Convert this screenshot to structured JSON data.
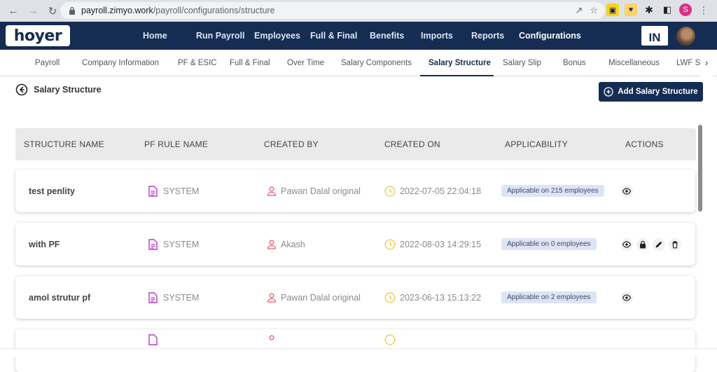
{
  "browser": {
    "url_host": "payroll.zimyo.work",
    "url_path": "/payroll/configurations/structure",
    "profile_initial": "S"
  },
  "topnav": {
    "logo": "hoyer",
    "items": [
      "Home",
      "Run Payroll",
      "Employees",
      "Full & Final",
      "Benefits",
      "Imports",
      "Reports",
      "Configurations"
    ],
    "active": "Configurations",
    "country_badge": "IN"
  },
  "subnav": {
    "items": [
      "Payroll",
      "Company Information",
      "PF & ESIC",
      "Full & Final",
      "Over Time",
      "Salary Components",
      "Salary Structure",
      "Salary Slip",
      "Bonus",
      "Miscellaneous",
      "LWF S"
    ],
    "active": "Salary Structure"
  },
  "page": {
    "title": "Salary Structure",
    "add_button": "Add Salary Structure"
  },
  "table": {
    "columns": [
      "STRUCTURE NAME",
      "PF RULE NAME",
      "CREATED BY",
      "CREATED ON",
      "APPLICABILITY",
      "ACTIONS"
    ],
    "rows": [
      {
        "name": "test penlity",
        "pf_rule": "SYSTEM",
        "created_by": "Pawan Dalal original",
        "created_on": "2022-07-05 22:04:18",
        "applicability": "Applicable on 215 employees",
        "actions": [
          "view-icon"
        ]
      },
      {
        "name": "with PF",
        "pf_rule": "SYSTEM",
        "created_by": "Akash",
        "created_on": "2022-08-03 14:29:15",
        "applicability": "Applicable on 0 employees",
        "actions": [
          "view-icon",
          "lock-icon",
          "edit-icon",
          "delete-icon"
        ]
      },
      {
        "name": "amol strutur pf",
        "pf_rule": "SYSTEM",
        "created_by": "Pawan Dalal original",
        "created_on": "2023-06-13 15:13:22",
        "applicability": "Applicable on 2 employees",
        "actions": [
          "view-icon"
        ]
      }
    ]
  },
  "colors": {
    "navy": "#152c53",
    "doc_icon": "#b23bc5",
    "user_icon": "#ef5d6f",
    "clock_icon": "#f2c94c",
    "badge_bg": "#dde5f5"
  }
}
